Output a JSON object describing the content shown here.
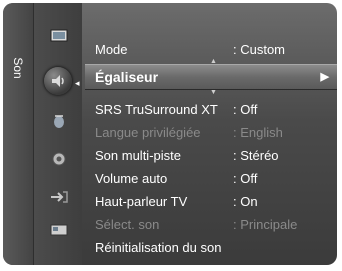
{
  "side_tab": {
    "label": "Son"
  },
  "icons": [
    {
      "name": "picture-icon"
    },
    {
      "name": "sound-icon"
    },
    {
      "name": "channel-icon"
    },
    {
      "name": "setup-icon"
    },
    {
      "name": "input-icon"
    },
    {
      "name": "application-icon"
    }
  ],
  "menu": {
    "mode": {
      "label": "Mode",
      "value": ": Custom"
    },
    "equalizer": {
      "label": "Égaliseur",
      "arrow": "▶"
    },
    "srs": {
      "label": "SRS TruSurround XT",
      "value": ": Off"
    },
    "langue": {
      "label": "Langue privilégiée",
      "value": ": English"
    },
    "multipiste": {
      "label": "Son multi-piste",
      "value": ": Stéréo"
    },
    "volume_auto": {
      "label": "Volume auto",
      "value": ": Off"
    },
    "haut_parleur": {
      "label": "Haut-parleur TV",
      "value": ": On"
    },
    "select_son": {
      "label": "Sélect. son",
      "value": ": Principale"
    },
    "reinit": {
      "label": "Réinitialisation du son"
    }
  },
  "colors": {
    "panel": "#4a4a4a",
    "selected": "#7a7a7a",
    "text": "#ffffff",
    "disabled": "#8a8a8a"
  }
}
